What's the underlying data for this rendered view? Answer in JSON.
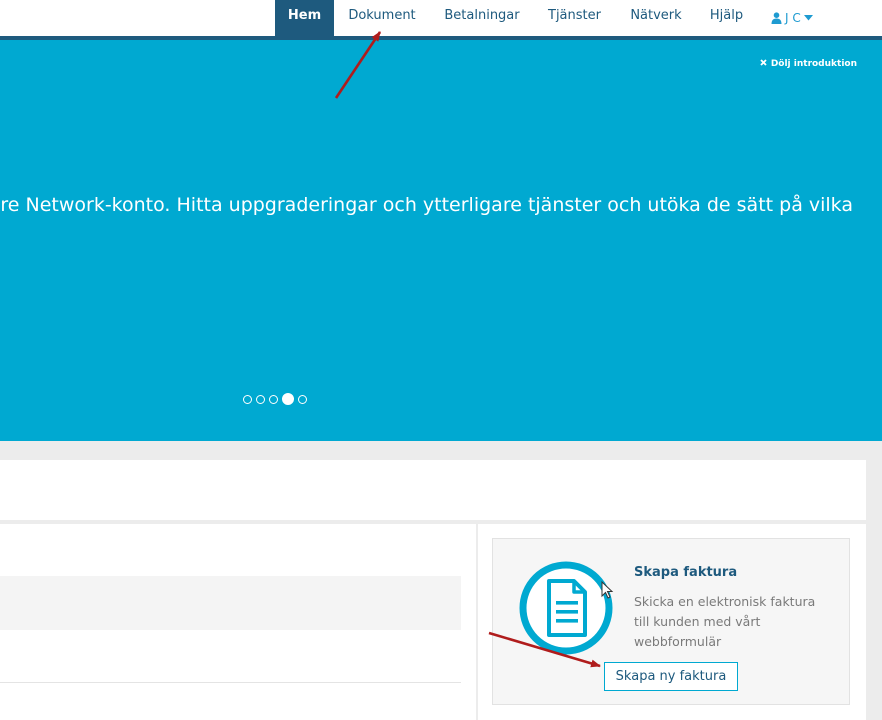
{
  "nav": {
    "items": [
      {
        "label": "Hem",
        "active": true
      },
      {
        "label": "Dokument",
        "active": false
      },
      {
        "label": "Betalningar",
        "active": false
      },
      {
        "label": "Tjänster",
        "active": false
      },
      {
        "label": "Nätverk",
        "active": false
      },
      {
        "label": "Hjälp",
        "active": false
      }
    ],
    "user": {
      "initials": "J C",
      "icon": "user-icon",
      "caret_icon": "caret-down-icon"
    }
  },
  "intro": {
    "close_label": "Dölj introduktion",
    "close_icon": "close-icon",
    "text": "are Network-konto. Hitta uppgraderingar och ytterligare tjänster och utöka de sätt på vilka",
    "dots_total": 5,
    "active_dot": 4
  },
  "invoice_card": {
    "icon": "document-icon",
    "title": "Skapa faktura",
    "description_lines": [
      "Skicka en elektronisk faktura",
      "till kunden med vårt",
      "webbformulär"
    ],
    "button_label": "Skapa ny faktura"
  },
  "colors": {
    "nav_dark": "#1e5a7e",
    "intro_bg": "#00a9d1",
    "annotation_arrow": "#b01c1c"
  }
}
